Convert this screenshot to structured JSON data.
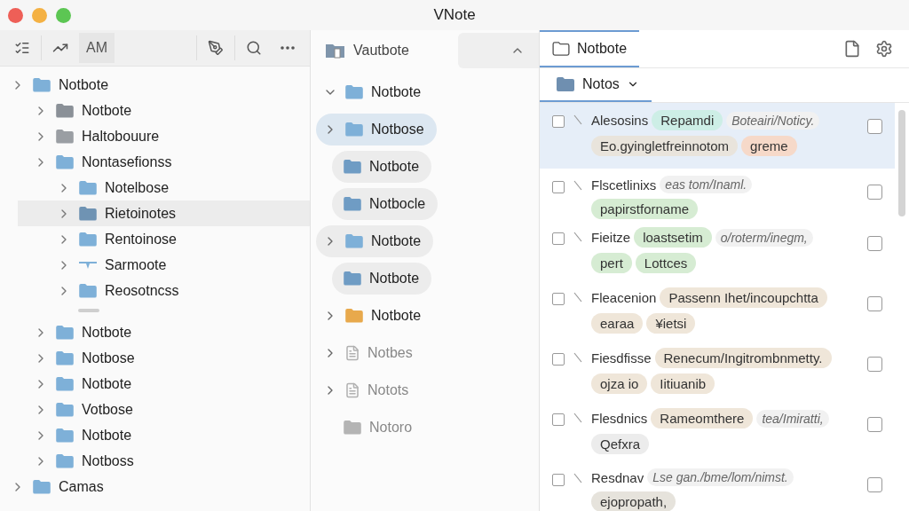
{
  "window": {
    "title": "VNote"
  },
  "toolbar": {
    "label": "AM"
  },
  "tree": [
    {
      "label": "Notbote",
      "kind": "folder",
      "color": "#7eb0d8",
      "selected": false,
      "children": [
        {
          "label": "Notbote",
          "kind": "folder",
          "color": "#8a9097",
          "selected": false
        },
        {
          "label": "Haltobouure",
          "kind": "folder",
          "color": "#9a9ea3",
          "selected": false
        },
        {
          "label": "Nontasefionss",
          "kind": "folder",
          "color": "#7eb0d8",
          "selected": false,
          "children": [
            {
              "label": "Notelbose",
              "kind": "folder",
              "color": "#7eb0d8",
              "selected": false
            },
            {
              "label": "Rietoinotes",
              "kind": "folder",
              "color": "#6f93b3",
              "selected": true
            },
            {
              "label": "Rentoinose",
              "kind": "folder",
              "color": "#7eb0d8",
              "selected": false
            },
            {
              "label": "Sarmoote",
              "kind": "filter",
              "color": "#7eb0d8",
              "selected": false
            },
            {
              "label": "Reosotncss",
              "kind": "folder",
              "color": "#7eb0d8",
              "selected": false
            }
          ]
        },
        {
          "label": "Notbote",
          "kind": "folder",
          "color": "#7eb0d8",
          "selected": false
        },
        {
          "label": "Notbose",
          "kind": "folder",
          "color": "#7eb0d8",
          "selected": false
        },
        {
          "label": "Notbote",
          "kind": "folder",
          "color": "#7eb0d8",
          "selected": false
        },
        {
          "label": "Votbose",
          "kind": "folder",
          "color": "#7eb0d8",
          "selected": false
        },
        {
          "label": "Notbote",
          "kind": "folder",
          "color": "#7eb0d8",
          "selected": false
        },
        {
          "label": "Notboss",
          "kind": "folder",
          "color": "#7eb0d8",
          "selected": false
        }
      ]
    },
    {
      "label": "Camas",
      "kind": "folder",
      "color": "#7eb0d8",
      "selected": false
    }
  ],
  "notebook": {
    "title": "Vautbote"
  },
  "folders": [
    {
      "label": "Notbote",
      "kind": "folder",
      "expandable": true,
      "expanded": true,
      "selected": false,
      "pill": false,
      "color": "#7eb0d8",
      "dimmed": false
    },
    {
      "label": "Notbose",
      "kind": "folder",
      "expandable": true,
      "expanded": false,
      "selected": true,
      "pill": true,
      "color": "#7eb0d8",
      "dimmed": false
    },
    {
      "label": "Notbote",
      "kind": "folder",
      "expandable": false,
      "selected": false,
      "pill": true,
      "color": "#6f9cc4",
      "dimmed": false
    },
    {
      "label": "Notbocle",
      "kind": "folder",
      "expandable": false,
      "selected": false,
      "pill": true,
      "color": "#6f9cc4",
      "dimmed": false
    },
    {
      "label": "Notbote",
      "kind": "folder",
      "expandable": true,
      "expanded": false,
      "selected": false,
      "pill": true,
      "color": "#7eb0d8",
      "dimmed": false
    },
    {
      "label": "Notbote",
      "kind": "folder",
      "expandable": false,
      "selected": false,
      "pill": true,
      "color": "#6f9cc4",
      "dimmed": false
    },
    {
      "label": "Notbote",
      "kind": "folder",
      "expandable": true,
      "expanded": false,
      "selected": false,
      "pill": false,
      "color": "#e8a94c",
      "dimmed": false
    },
    {
      "label": "Notbes",
      "kind": "document",
      "expandable": true,
      "expanded": false,
      "selected": false,
      "pill": false,
      "color": "#b0b0b0",
      "dimmed": true
    },
    {
      "label": "Notots",
      "kind": "document",
      "expandable": true,
      "expanded": false,
      "selected": false,
      "pill": false,
      "color": "#b0b0b0",
      "dimmed": true
    },
    {
      "label": "Notoro",
      "kind": "folder",
      "expandable": false,
      "selected": false,
      "pill": false,
      "color": "#b4b4b4",
      "dimmed": true
    }
  ],
  "tab": {
    "label": "Notbote",
    "selected": true
  },
  "filter": {
    "label": "Notos"
  },
  "notes": [
    {
      "title": "Alesosins",
      "inline_tags": [
        {
          "label": "Repamdi",
          "color": "#cdeee6"
        }
      ],
      "path": "Boteairi/Noticy.",
      "tags": [
        {
          "label": "Eo.gyingletfreinnotom",
          "color": "#e9e4dc"
        },
        {
          "label": "greme",
          "color": "#f6d9c9"
        }
      ],
      "selected": true,
      "checked": false
    },
    {
      "title": "Flscetlinixs",
      "path": "eas tom/Inaml.",
      "tags": [
        {
          "label": "papirstforname",
          "color": "#d6ecd3"
        }
      ],
      "selected": false,
      "checked": false
    },
    {
      "title": "Fieitze",
      "inline_tags": [
        {
          "label": "loastsetim",
          "color": "#d6ecd3"
        }
      ],
      "path": "o/roterm/inegm,",
      "tags": [
        {
          "label": "pert",
          "color": "#d6ecd3"
        },
        {
          "label": "Lottces",
          "color": "#d6ecd3"
        }
      ],
      "selected": false,
      "checked": false
    },
    {
      "title": "Fleacenion",
      "inline_tags": [
        {
          "label": "Passenn Ihet/incoupchtta",
          "color": "#efe6d9"
        }
      ],
      "tags": [
        {
          "label": "earaa",
          "color": "#efe6d9"
        },
        {
          "label": "¥ietsi",
          "color": "#efe6d9"
        }
      ],
      "selected": false,
      "checked": false
    },
    {
      "title": "Fiesdfisse",
      "inline_tags": [
        {
          "label": "Renecum/Ingitrombnmetty.",
          "color": "#efe6d9"
        }
      ],
      "tags": [
        {
          "label": "ojza io",
          "color": "#efe6d9"
        },
        {
          "label": "Iitiuanib",
          "color": "#efe6d9"
        }
      ],
      "selected": false,
      "checked": false
    },
    {
      "title": "Flesdnics",
      "inline_tags": [
        {
          "label": "Rameomthere",
          "color": "#efe6d9"
        }
      ],
      "path": "tea/Imiratti,",
      "tags": [
        {
          "label": "Qefxra",
          "color": "#ececec"
        }
      ],
      "selected": false,
      "checked": false
    },
    {
      "title": "Resdnav",
      "path": "Lse gan./bme/lom/nimst.",
      "tags": [
        {
          "label": "ejopropath,",
          "color": "#e6e3dc"
        }
      ],
      "selected": false,
      "checked": false
    }
  ]
}
